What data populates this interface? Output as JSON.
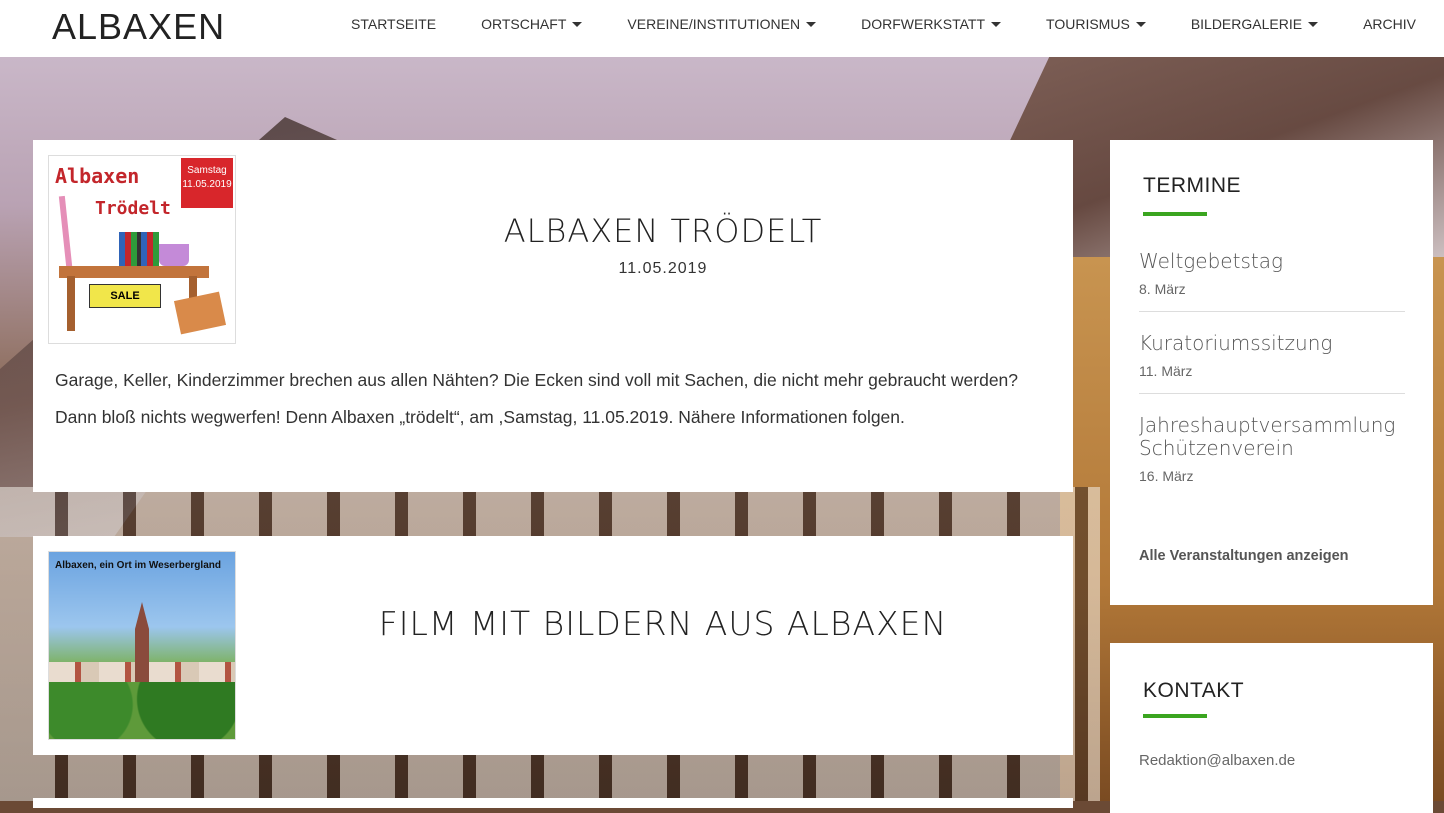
{
  "site": {
    "brand": "ALBAXEN"
  },
  "nav": [
    {
      "label": "STARTSEITE",
      "dropdown": false
    },
    {
      "label": "ORTSCHAFT",
      "dropdown": true
    },
    {
      "label": "VEREINE/INSTITUTIONEN",
      "dropdown": true
    },
    {
      "label": "DORFWERKSTATT",
      "dropdown": true
    },
    {
      "label": "TOURISMUS",
      "dropdown": true
    },
    {
      "label": "BILDERGALERIE",
      "dropdown": true
    },
    {
      "label": "ARCHIV",
      "dropdown": false
    }
  ],
  "posts": [
    {
      "title": "ALBAXEN TRÖDELT",
      "date": "11.05.2019",
      "body": "Garage, Keller, Kinderzimmer brechen aus allen Nähten? Die Ecken sind voll mit Sachen, die nicht mehr gebraucht werden? Dann bloß nichts wegwerfen! Denn Albaxen „trödelt“, am ,Samstag, 11.05.2019. Nähere Informationen folgen.",
      "thumb": {
        "label1": "Albaxen",
        "label2": "Trödelt",
        "badge_line1": "Samstag",
        "badge_line2": "11.05.2019",
        "sale": "SALE"
      }
    },
    {
      "title": "FILM MIT BILDERN AUS ALBAXEN",
      "thumb": {
        "caption": "Albaxen, ein Ort im Weserbergland"
      }
    }
  ],
  "sidebar": {
    "termine": {
      "title": "TERMINE",
      "events": [
        {
          "title": "Weltgebetstag",
          "date": "8. März"
        },
        {
          "title": "Kuratoriumssitzung",
          "date": "11. März"
        },
        {
          "title": "Jahreshauptversammlung Schützenverein",
          "date": "16. März"
        }
      ],
      "all_link": "Alle Veranstaltungen anzeigen"
    },
    "kontakt": {
      "title": "KONTAKT",
      "email": "Redaktion@albaxen.de"
    }
  },
  "colors": {
    "accent": "#3aa51f",
    "badge": "#d8262b"
  }
}
